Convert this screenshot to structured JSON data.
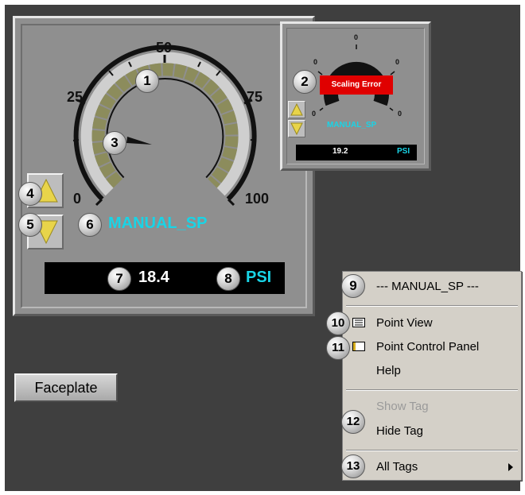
{
  "gauge_main": {
    "scale_labels": [
      "0",
      "25",
      "50",
      "75",
      "100"
    ],
    "tag_name": "MANUAL_SP",
    "value": "18.4",
    "unit": "PSI"
  },
  "gauge_small": {
    "scale_labels": [
      "0",
      "0",
      "0",
      "0",
      "0"
    ],
    "error_text": "Scaling Error",
    "tag_name": "MANUAL_SP",
    "value": "19.2",
    "unit": "PSI"
  },
  "callouts": [
    "1",
    "2",
    "3",
    "4",
    "5",
    "6",
    "7",
    "8",
    "9",
    "10",
    "11",
    "12",
    "13"
  ],
  "faceplate_button": "Faceplate",
  "context_menu": {
    "header": "--- MANUAL_SP ---",
    "items": [
      {
        "label": "Point View",
        "icon": "point-view-icon"
      },
      {
        "label": "Point Control Panel",
        "icon": "control-panel-icon"
      },
      {
        "label": "Help"
      },
      {
        "label": "Show Tag",
        "disabled": true
      },
      {
        "label": "Hide Tag"
      },
      {
        "label": "All Tags",
        "submenu": true
      }
    ]
  },
  "colors": {
    "accent": "#19d4e6",
    "error": "#e00000",
    "panel": "#8f8f8f",
    "background": "#3f3f3f"
  }
}
